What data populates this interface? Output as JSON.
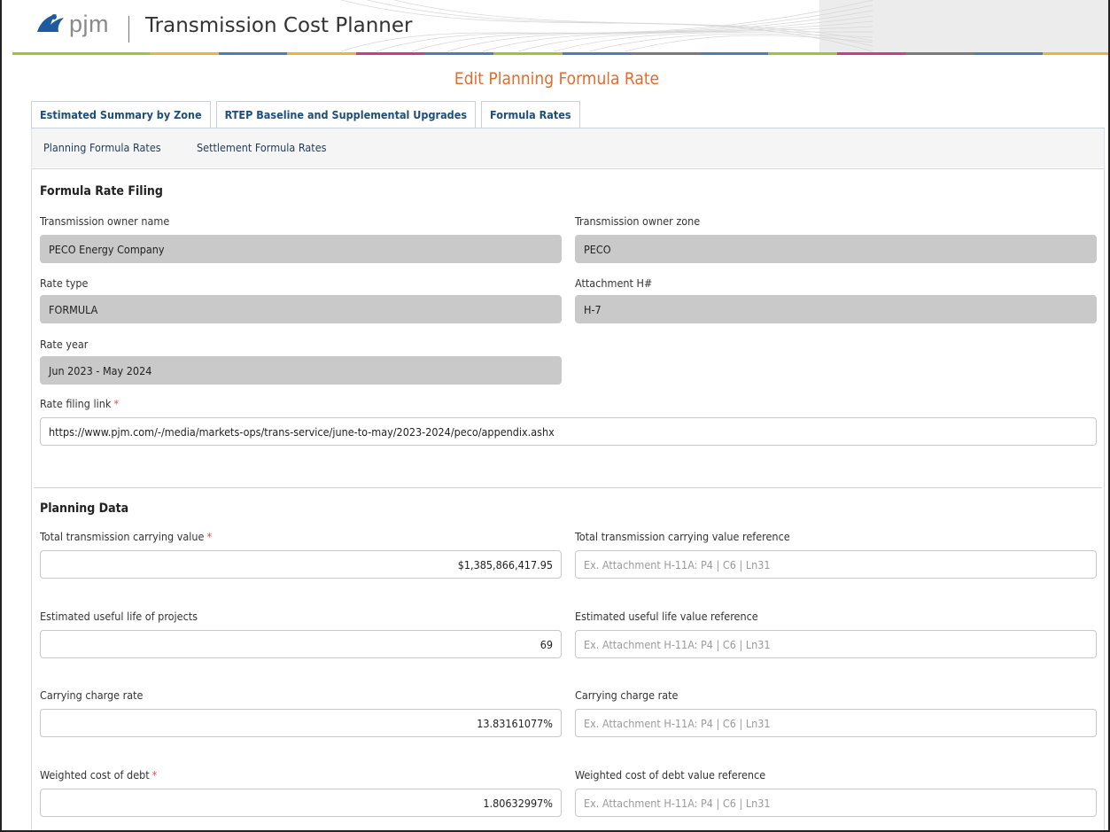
{
  "header": {
    "logo_text": "pjm",
    "app_title": "Transmission Cost Planner",
    "colorbar": [
      "#9ec23b",
      "#9ec23b",
      "#f2b233",
      "#4d7bbf",
      "#f2b233",
      "#d8358f",
      "#4d7bbf",
      "#9ec23b",
      "#4d7bbf",
      "#7a7a7a",
      "#4d7bbf",
      "#9ec23b",
      "#d8358f",
      "#7a7a7a",
      "#4d7bbf",
      "#f2b233"
    ]
  },
  "page_title": "Edit Planning Formula Rate",
  "tabs": [
    {
      "label": "Estimated Summary by Zone"
    },
    {
      "label": "RTEP Baseline and Supplemental Upgrades"
    },
    {
      "label": "Formula Rates"
    }
  ],
  "subnav": [
    {
      "label": "Planning Formula Rates"
    },
    {
      "label": "Settlement Formula Rates"
    }
  ],
  "filing": {
    "title": "Formula Rate Filing",
    "owner_name_label": "Transmission owner name",
    "owner_name_value": "PECO Energy Company",
    "owner_zone_label": "Transmission owner zone",
    "owner_zone_value": "PECO",
    "rate_type_label": "Rate type",
    "rate_type_value": "FORMULA",
    "attachment_label": "Attachment H#",
    "attachment_value": "H-7",
    "rate_year_label": "Rate year",
    "rate_year_value": "Jun 2023 - May 2024",
    "link_label": "Rate filing link",
    "required_mark": "*",
    "link_value": "https://www.pjm.com/-/media/markets-ops/trans-service/june-to-may/2023-2024/peco/appendix.ashx"
  },
  "planning": {
    "title": "Planning Data",
    "reference_placeholder": "Ex. Attachment H-11A: P4 | C6 | Ln31",
    "rows": [
      {
        "label": "Total transmission carrying value",
        "required": true,
        "value": "$1,385,866,417.95",
        "ref_label": "Total transmission carrying value reference"
      },
      {
        "label": "Estimated useful life of projects",
        "required": false,
        "value": "69",
        "ref_label": "Estimated useful life value reference"
      },
      {
        "label": "Carrying charge rate",
        "required": false,
        "value": "13.83161077%",
        "ref_label": "Carrying charge rate"
      },
      {
        "label": "Weighted cost of debt",
        "required": true,
        "value": "1.80632997%",
        "ref_label": "Weighted cost of debt value reference"
      }
    ]
  }
}
